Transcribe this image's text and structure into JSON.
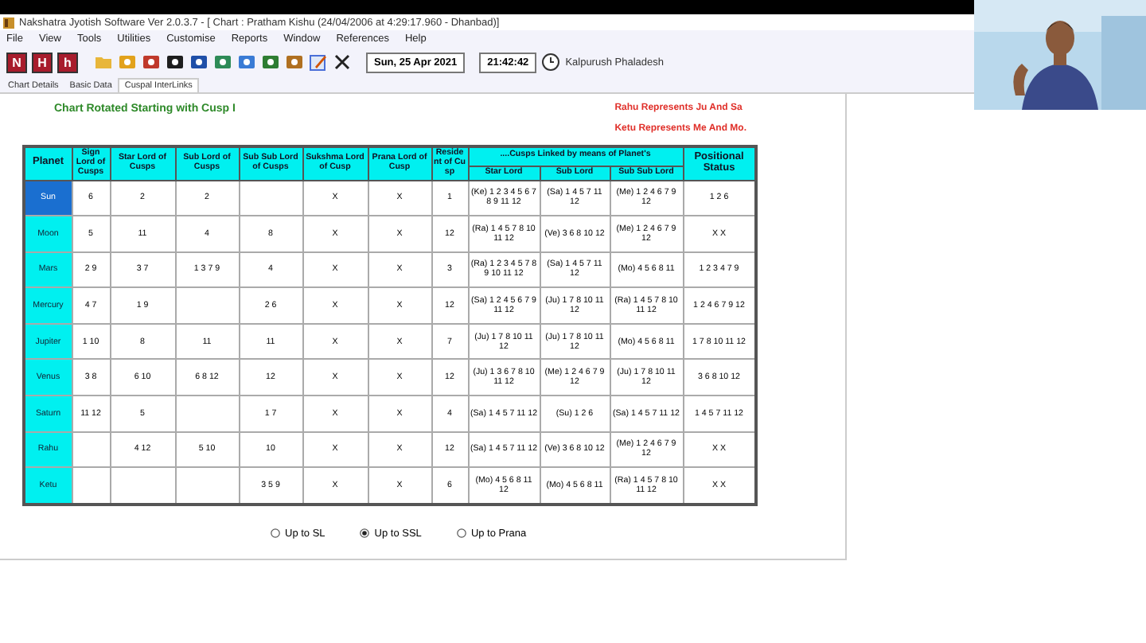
{
  "window": {
    "title": "Nakshatra Jyotish Software Ver 2.0.3.7 - [ Chart : Pratham Kishu (24/04/2006 at 4:29:17.960 - Dhanbad)]"
  },
  "menu": [
    "File",
    "View",
    "Tools",
    "Utilities",
    "Customise",
    "Reports",
    "Window",
    "References",
    "Help"
  ],
  "toolbar": {
    "letter_buttons": [
      "N",
      "H",
      "h"
    ],
    "date": "Sun, 25 Apr 2021",
    "time": "21:42:42",
    "clock_label": "Kalpurush Phaladesh"
  },
  "tabs": [
    {
      "label": "Chart Details",
      "selected": false
    },
    {
      "label": "Basic Data",
      "selected": false
    },
    {
      "label": "Cuspal InterLinks",
      "selected": true
    }
  ],
  "chart_heading": "Chart Rotated Starting with Cusp I",
  "notes": [
    "Rahu Represents Ju And Sa",
    "Ketu Represents Me And Mo."
  ],
  "table": {
    "columns": [
      "Planet",
      "Sign Lord of Cusps",
      "Star Lord of Cusps",
      "Sub Lord of Cusps",
      "Sub Sub Lord of Cusps",
      "Sukshma Lord of Cusp",
      "Prana Lord of Cusp",
      "Resident of Cusp"
    ],
    "group": {
      "label": "....Cusps Linked by means of Planet's",
      "columns": [
        "Star Lord",
        "Sub Lord",
        "Sub Sub Lord"
      ]
    },
    "last_column": "Positional Status",
    "rows": [
      {
        "selected": true,
        "cells": [
          "Sun",
          "6",
          "2",
          "2",
          "",
          "X",
          "X",
          "1",
          "(Ke) 1 2 3 4 5 6 7 8 9 11 12",
          "(Sa) 1 4 5 7 11 12",
          "(Me) 1 2 4 6 7 9 12",
          "1 2 6"
        ]
      },
      {
        "selected": false,
        "cells": [
          "Moon",
          "5",
          "11",
          "4",
          "8",
          "X",
          "X",
          "12",
          "(Ra) 1 4 5 7 8 10 11 12",
          "(Ve) 3 6 8 10 12",
          "(Me) 1 2 4 6 7 9 12",
          "X X"
        ]
      },
      {
        "selected": false,
        "cells": [
          "Mars",
          "2 9",
          "3 7",
          "1 3 7 9",
          "4",
          "X",
          "X",
          "3",
          "(Ra) 1 2 3 4 5 7 8 9 10 11 12",
          "(Sa) 1 4 5 7 11 12",
          "(Mo) 4 5 6 8 11",
          "1 2 3 4 7 9"
        ]
      },
      {
        "selected": false,
        "cells": [
          "Mercury",
          "4 7",
          "1 9",
          "",
          "2 6",
          "X",
          "X",
          "12",
          "(Sa) 1 2 4 5 6 7 9 11 12",
          "(Ju) 1 7 8 10 11 12",
          "(Ra) 1 4 5 7 8 10 11 12",
          "1 2 4 6 7 9 12"
        ]
      },
      {
        "selected": false,
        "cells": [
          "Jupiter",
          "1 10",
          "8",
          "11",
          "11",
          "X",
          "X",
          "7",
          "(Ju) 1 7 8 10 11 12",
          "(Ju) 1 7 8 10 11 12",
          "(Mo) 4 5 6 8 11",
          "1 7 8 10 11 12"
        ]
      },
      {
        "selected": false,
        "cells": [
          "Venus",
          "3 8",
          "6 10",
          "6 8 12",
          "12",
          "X",
          "X",
          "12",
          "(Ju) 1 3 6 7 8 10 11 12",
          "(Me) 1 2 4 6 7 9 12",
          "(Ju) 1 7 8 10 11 12",
          "3 6 8 10 12"
        ]
      },
      {
        "selected": false,
        "cells": [
          "Saturn",
          "11 12",
          "5",
          "",
          "1 7",
          "X",
          "X",
          "4",
          "(Sa) 1 4 5 7 11 12",
          "(Su) 1 2 6",
          "(Sa) 1 4 5 7 11 12",
          "1 4 5 7 11 12"
        ]
      },
      {
        "selected": false,
        "cells": [
          "Rahu",
          "",
          "4 12",
          "5 10",
          "10",
          "X",
          "X",
          "12",
          "(Sa) 1 4 5 7 11 12",
          "(Ve) 3 6 8 10 12",
          "(Me) 1 2 4 6 7 9 12",
          "X X"
        ]
      },
      {
        "selected": false,
        "cells": [
          "Ketu",
          "",
          "",
          "",
          "3 5 9",
          "X",
          "X",
          "6",
          "(Mo) 4 5 6 8 11 12",
          "(Mo) 4 5 6 8 11",
          "(Ra) 1 4 5 7 8 10 11 12",
          "X X"
        ]
      }
    ]
  },
  "options": [
    {
      "label": "Up to SL",
      "selected": false
    },
    {
      "label": "Up to SSL",
      "selected": true
    },
    {
      "label": "Up to Prana",
      "selected": false
    }
  ]
}
